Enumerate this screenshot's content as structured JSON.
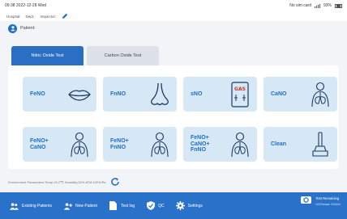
{
  "status": {
    "datetime": "09:38 2022-12-28 Wed",
    "sim": "No sim card",
    "battery": "93%"
  },
  "info": {
    "hospital_label": "Hospital:",
    "dept_label": "Dept.:",
    "inspector_label": "Inspector:"
  },
  "patient": {
    "label": "Patient:"
  },
  "tabs": [
    {
      "label": "Nitric Oxide Test",
      "active": true
    },
    {
      "label": "Carbon Oxide Test",
      "active": false
    }
  ],
  "tests": [
    {
      "label": "FeNO",
      "icon": "lips-icon"
    },
    {
      "label": "FnNO",
      "icon": "nose-icon"
    },
    {
      "label": "sNO",
      "icon": "gas-bag-icon",
      "icon_text": "GAS"
    },
    {
      "label": "CaNO",
      "icon": "lungs-person-icon"
    },
    {
      "label": "FeNO+\nCaNO",
      "icon": "lungs-person-icon"
    },
    {
      "label": "FeNO+\nFnNO",
      "icon": "lungs-person-icon"
    },
    {
      "label": "FeNO+\nCaNO+\nFnNO",
      "icon": "lungs-person-icon"
    },
    {
      "label": "Clean",
      "icon": "brush-icon"
    }
  ],
  "environment": {
    "text": "Environment Parameters:Temp:15.2℃   Humidity:32%   ATM:1021hPa"
  },
  "nav": {
    "items": [
      {
        "label": "Existing Patients",
        "icon": "patients-icon"
      },
      {
        "label": "New Patient",
        "icon": "add-patient-icon"
      },
      {
        "label": "Test log",
        "icon": "document-icon"
      },
      {
        "label": "QC",
        "icon": "shield-check-icon"
      },
      {
        "label": "Settings",
        "icon": "gear-icon"
      }
    ],
    "remaining_label": "Test Remaining",
    "remaining_value": "NO/Remain 3334/ch"
  },
  "colors": {
    "primary": "#2a72c9",
    "card_bg": "#d6e7f6",
    "card_text": "#1e6fc6"
  }
}
